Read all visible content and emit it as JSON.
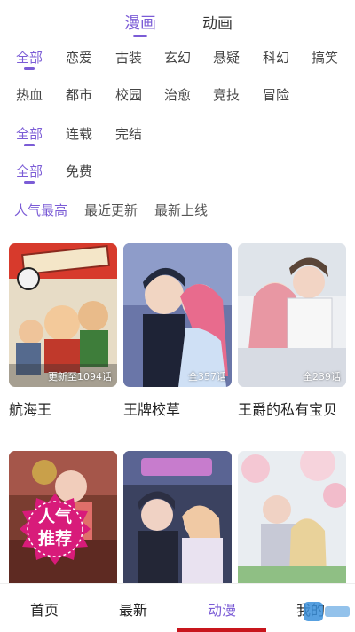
{
  "top_tabs": [
    {
      "label": "漫画",
      "active": true
    },
    {
      "label": "动画",
      "active": false
    }
  ],
  "filters": {
    "genres": [
      "全部",
      "恋爱",
      "古装",
      "玄幻",
      "悬疑",
      "科幻",
      "搞笑",
      "热血",
      "都市",
      "校园",
      "治愈",
      "竞技",
      "冒险"
    ],
    "status": [
      "全部",
      "连载",
      "完结"
    ],
    "pricing": [
      "全部",
      "免费"
    ]
  },
  "sort": [
    "人气最高",
    "最近更新",
    "最新上线"
  ],
  "comics": [
    {
      "title": "航海王",
      "badge": "更新至1094话"
    },
    {
      "title": "王牌校草",
      "badge": "全357话"
    },
    {
      "title": "王爵的私有宝贝",
      "badge": "全239话"
    },
    {
      "title": "",
      "badge": ""
    },
    {
      "title": "",
      "badge": ""
    },
    {
      "title": "",
      "badge": ""
    }
  ],
  "promo": {
    "line1": "人气",
    "line2": "推荐"
  },
  "bottom_nav": [
    "首页",
    "最新",
    "动漫",
    "我的"
  ],
  "colors": {
    "accent": "#7b5cd6",
    "nav_indicator": "#c8161d",
    "promo": "#d81b7a"
  }
}
